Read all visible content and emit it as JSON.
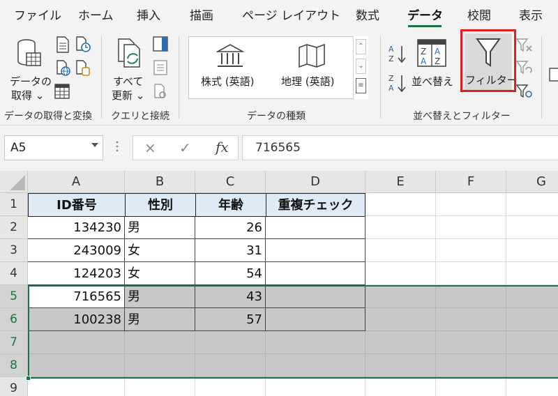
{
  "tabs": [
    {
      "label": "ファイル",
      "active": false
    },
    {
      "label": "ホーム",
      "active": false
    },
    {
      "label": "挿入",
      "active": false
    },
    {
      "label": "描画",
      "active": false
    },
    {
      "label": "ページ レイアウト",
      "active": false
    },
    {
      "label": "数式",
      "active": false
    },
    {
      "label": "データ",
      "active": true
    },
    {
      "label": "校閲",
      "active": false
    },
    {
      "label": "表示",
      "active": false
    }
  ],
  "ribbon": {
    "get_data": {
      "line1": "データの",
      "line2": "取得 ⌄"
    },
    "refresh_all": {
      "line1": "すべて",
      "line2": "更新 ⌄"
    },
    "data_types": {
      "stocks": "株式 (英語)",
      "geography": "地理 (英語)"
    },
    "sort_label": "並べ替え",
    "filter_label": "フィルター",
    "groups": {
      "get_transform": "データの取得と変換",
      "queries": "クエリと接続",
      "data_types": "データの種類",
      "sort_filter": "並べ替えとフィルター"
    },
    "accent_color": "#1e7145",
    "highlight_color": "#e0201f"
  },
  "formula_bar": {
    "name_box": "A5",
    "cancel_icon": "×",
    "enter_icon": "✓",
    "fx": "fx",
    "value": "716565"
  },
  "sheet": {
    "columns": [
      "A",
      "B",
      "C",
      "D",
      "E",
      "F",
      "G"
    ],
    "rows": [
      "1",
      "2",
      "3",
      "4",
      "5",
      "6",
      "7",
      "8",
      "9"
    ],
    "header": [
      "ID番号",
      "性別",
      "年齢",
      "重複チェック"
    ],
    "data": [
      [
        "134230",
        "男",
        "26",
        ""
      ],
      [
        "243009",
        "女",
        "31",
        ""
      ],
      [
        "124203",
        "女",
        "54",
        ""
      ],
      [
        "716565",
        "男",
        "43",
        ""
      ],
      [
        "100238",
        "男",
        "57",
        ""
      ]
    ]
  }
}
